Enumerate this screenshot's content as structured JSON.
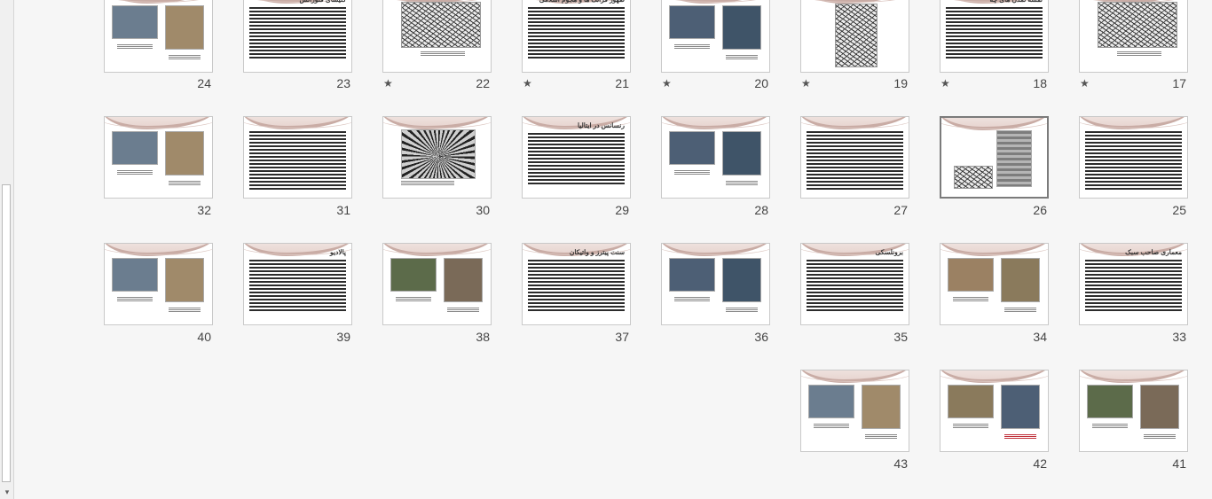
{
  "scrollbar": {
    "down_arrow": "▾"
  },
  "slides": [
    {
      "number": "24",
      "star": "",
      "title": "",
      "layout": "photos2"
    },
    {
      "number": "23",
      "star": "",
      "title": "کلیسای فلورانس",
      "layout": "text"
    },
    {
      "number": "22",
      "star": "★",
      "title": "",
      "layout": "sketch"
    },
    {
      "number": "21",
      "star": "★",
      "title": "ظهور فرانک ها و هجوم اسلامی",
      "layout": "text"
    },
    {
      "number": "20",
      "star": "★",
      "title": "",
      "layout": "photos2"
    },
    {
      "number": "19",
      "star": "★",
      "title": "",
      "layout": "sketch-center"
    },
    {
      "number": "18",
      "star": "★",
      "title": "نقشه تمدن های چه",
      "layout": "text"
    },
    {
      "number": "17",
      "star": "★",
      "title": "",
      "layout": "sketch"
    },
    {
      "number": "32",
      "star": "",
      "title": "",
      "layout": "photos2"
    },
    {
      "number": "31",
      "star": "",
      "title": "",
      "layout": "text-full"
    },
    {
      "number": "30",
      "star": "",
      "title": "",
      "layout": "vault"
    },
    {
      "number": "29",
      "star": "",
      "title": "رنسانس در ایتالیا",
      "layout": "text"
    },
    {
      "number": "28",
      "star": "",
      "title": "",
      "layout": "photos2"
    },
    {
      "number": "27",
      "star": "",
      "title": "",
      "layout": "text-full"
    },
    {
      "number": "26",
      "star": "",
      "title": "",
      "layout": "tower",
      "selected": true
    },
    {
      "number": "25",
      "star": "",
      "title": "",
      "layout": "text-full"
    },
    {
      "number": "40",
      "star": "",
      "title": "",
      "layout": "photos2"
    },
    {
      "number": "39",
      "star": "",
      "title": "پالادیو",
      "layout": "text"
    },
    {
      "number": "38",
      "star": "",
      "title": "",
      "layout": "photos2"
    },
    {
      "number": "37",
      "star": "",
      "title": "سنت پیترز و واتیکان",
      "layout": "text"
    },
    {
      "number": "36",
      "star": "",
      "title": "",
      "layout": "photos2"
    },
    {
      "number": "35",
      "star": "",
      "title": "برونلسکی",
      "layout": "text"
    },
    {
      "number": "34",
      "star": "",
      "title": "",
      "layout": "photos2"
    },
    {
      "number": "33",
      "star": "",
      "title": "معماری صاحب سبک",
      "layout": "text"
    },
    {
      "number": "43",
      "star": "",
      "title": "",
      "layout": "photos2"
    },
    {
      "number": "42",
      "star": "",
      "title": "",
      "layout": "photos2"
    },
    {
      "number": "41",
      "star": "",
      "title": "",
      "layout": "photos2"
    }
  ],
  "colors": {
    "swoosh": "#c9aca5",
    "selected_border": "#7b7b7b",
    "caption_red": "#c0303a"
  }
}
